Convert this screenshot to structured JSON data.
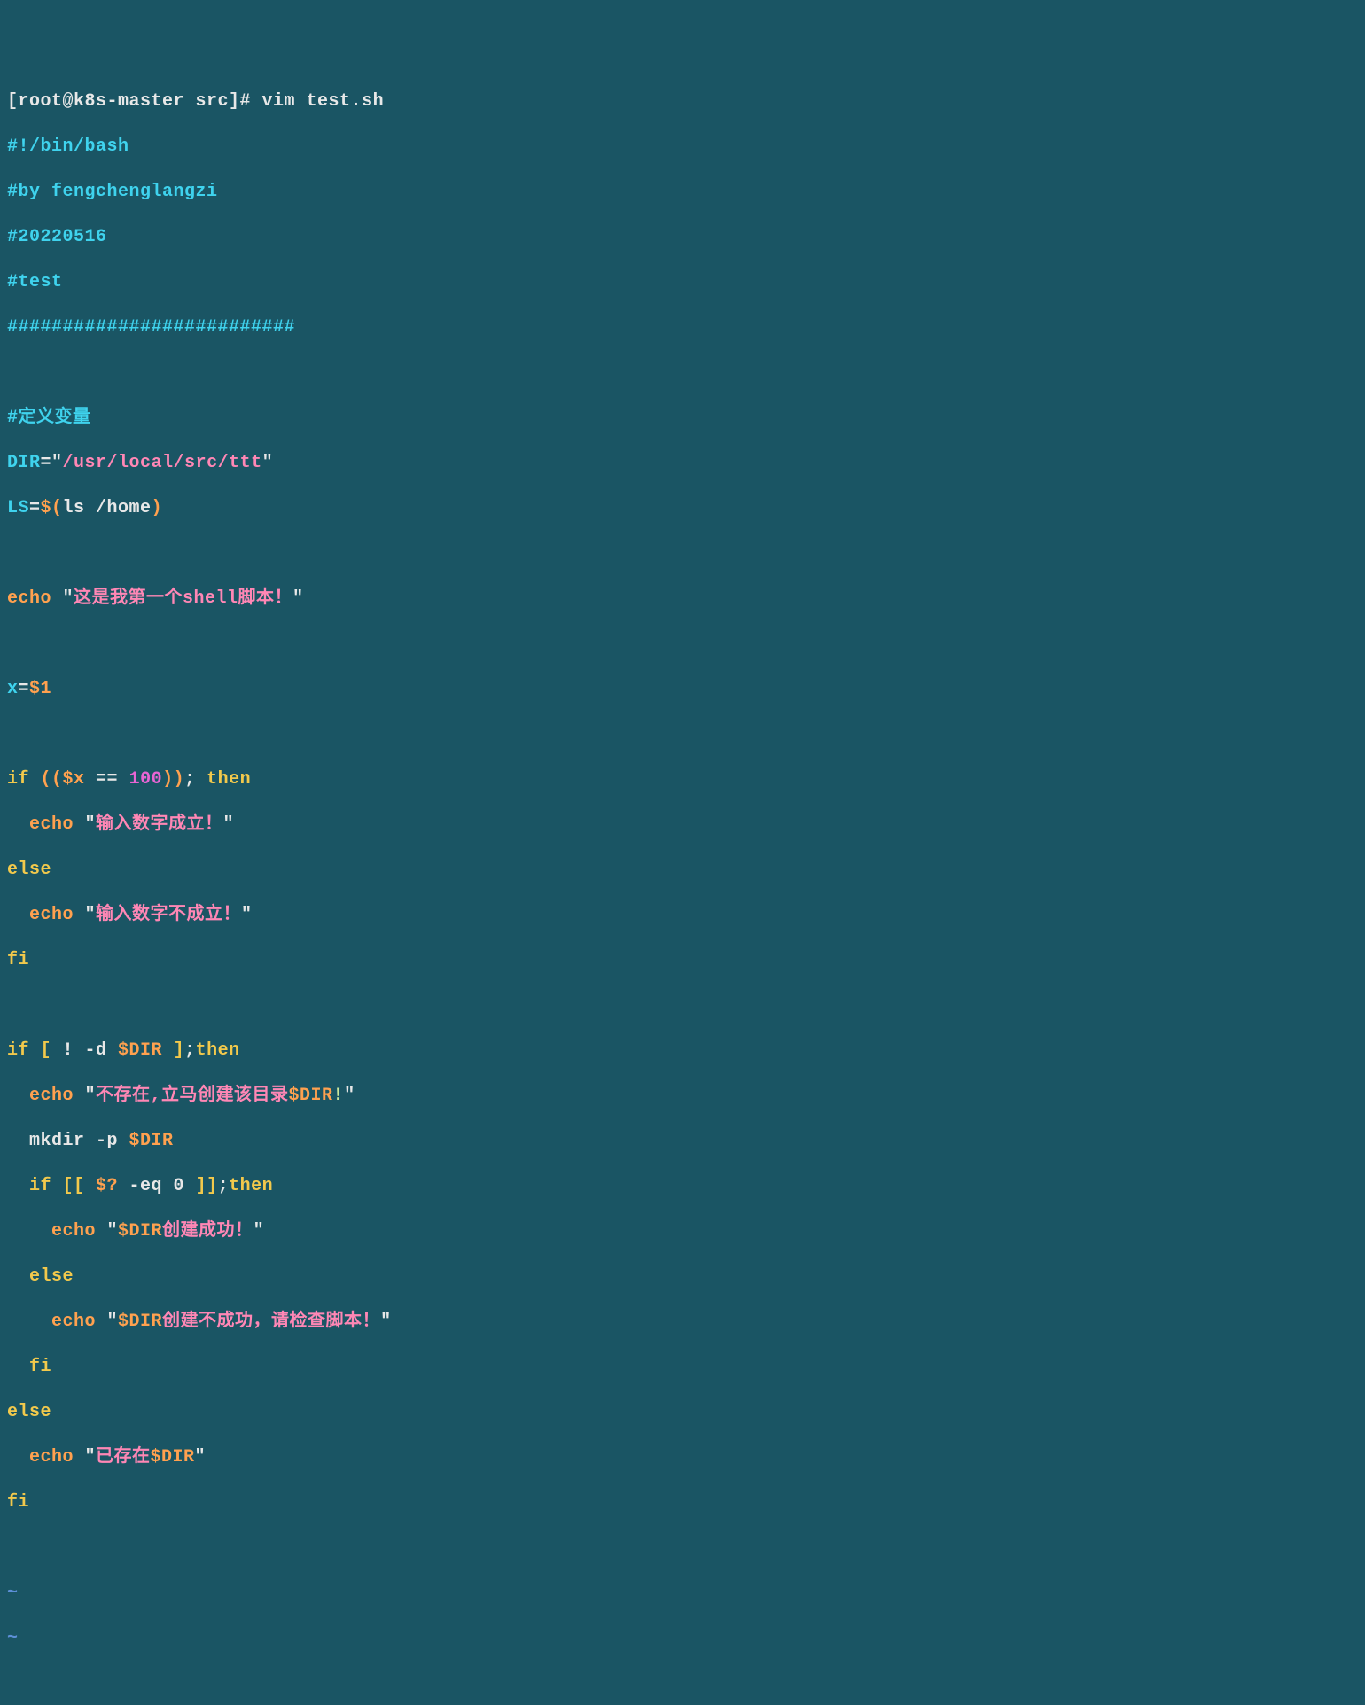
{
  "prompt_line": "[root@k8s-master src]# vim test.sh",
  "shebang": "#!/bin/bash",
  "comments": {
    "by": "#by fengchenglangzi",
    "date": "#20220516",
    "test": "#test",
    "sep": "##########################",
    "defvar": "#定义变量"
  },
  "assign": {
    "dir_var": "DIR",
    "dir_eq": "=",
    "dir_q1": "\"",
    "dir_path": "/usr/local/src/ttt",
    "dir_q2": "\"",
    "ls_var": "LS",
    "ls_eq": "=",
    "ls_o1": "$(",
    "ls_cmd": "ls /home",
    "ls_o2": ")"
  },
  "echo1": {
    "cmd": "echo ",
    "q1": "\"",
    "txt": "这是我第一个shell脚本！",
    "q2": "\""
  },
  "xassign": {
    "x": "x",
    "eq": "=",
    "val": "$1"
  },
  "if1": {
    "if": "if ",
    "op1": "((",
    "var": "$x",
    "mid": " == ",
    "num": "100",
    "op2": "))",
    "semi": ";",
    "then": " then",
    "echo_cmd": "  echo ",
    "q1": "\"",
    "txt_true": "输入数字成立！",
    "q2": "\"",
    "else": "else",
    "echo_cmd2": "  echo ",
    "q3": "\"",
    "txt_false": "输入数字不成立！",
    "q4": "\"",
    "fi": "fi"
  },
  "if2": {
    "if": "if ",
    "br1": "[",
    "cond": " ! -d ",
    "dirvar": "$DIR",
    "sp": " ",
    "br2": "]",
    "semi": ";",
    "then": "then",
    "echo1_cmd": "  echo ",
    "echo1_q1": "\"",
    "echo1_txt": "不存在,立马创建该目录",
    "echo1_var": "$DIR",
    "echo1_ex": "!",
    "echo1_q2": "\"",
    "mkdir": "  mkdir -p ",
    "mkdir_var": "$DIR",
    "if_inner": "  if ",
    "ibr1": "[[",
    "ivar": " $?",
    "icond": " -eq 0 ",
    "ibr2": "]]",
    "isemi": ";",
    "ithen": "then",
    "iecho1_cmd": "    echo ",
    "iecho1_q1": "\"",
    "iecho1_var": "$DIR",
    "iecho1_txt": "创建成功！",
    "iecho1_q2": "\"",
    "ielse": "  else",
    "iecho2_cmd": "    echo ",
    "iecho2_q1": "\"",
    "iecho2_var": "$DIR",
    "iecho2_txt": "创建不成功，请检查脚本！",
    "iecho2_q2": "\"",
    "ifi": "  fi",
    "else": "else",
    "echo2_cmd": "  echo ",
    "echo2_q1": "\"",
    "echo2_txt": "已存在",
    "echo2_var": "$DIR",
    "echo2_q2": "\"",
    "fi": "fi"
  },
  "tilde": "~"
}
